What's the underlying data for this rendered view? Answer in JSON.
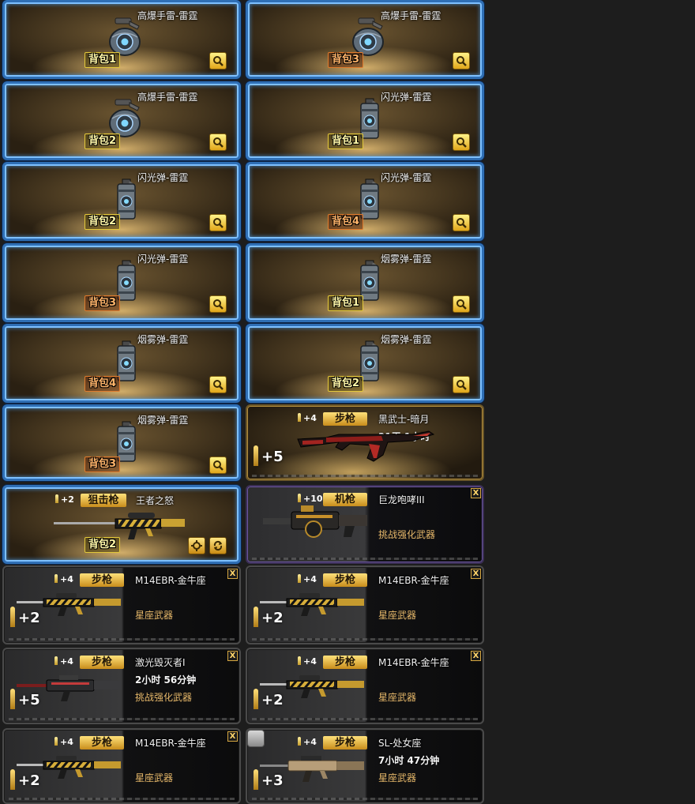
{
  "cards": [
    {
      "style": "blue",
      "kind": "grenade",
      "item": "he",
      "name": "高爆手雷-雷霆",
      "pack": "背包1",
      "packColor": "yellow",
      "btn": "zoom"
    },
    {
      "style": "blue",
      "kind": "grenade",
      "item": "he",
      "name": "高爆手雷-雷霆",
      "pack": "背包3",
      "packColor": "orange",
      "btn": "zoom"
    },
    {
      "style": "blue",
      "kind": "grenade",
      "item": "he",
      "name": "高爆手雷-雷霆",
      "pack": "背包2",
      "packColor": "yellow",
      "btn": "zoom"
    },
    {
      "style": "blue",
      "kind": "grenade",
      "item": "can",
      "name": "闪光弹-雷霆",
      "pack": "背包1",
      "packColor": "yellow",
      "btn": "zoom"
    },
    {
      "style": "blue",
      "kind": "grenade",
      "item": "can",
      "name": "闪光弹-雷霆",
      "pack": "背包2",
      "packColor": "yellow",
      "btn": "zoom"
    },
    {
      "style": "blue",
      "kind": "grenade",
      "item": "can",
      "name": "闪光弹-雷霆",
      "pack": "背包4",
      "packColor": "orange",
      "btn": "zoom"
    },
    {
      "style": "blue",
      "kind": "grenade",
      "item": "can",
      "name": "闪光弹-雷霆",
      "pack": "背包3",
      "packColor": "orange",
      "btn": "zoom"
    },
    {
      "style": "blue",
      "kind": "grenade",
      "item": "can",
      "name": "烟雾弹-雷霆",
      "pack": "背包1",
      "packColor": "yellow",
      "btn": "zoom"
    },
    {
      "style": "blue",
      "kind": "grenade",
      "item": "can",
      "name": "烟雾弹-雷霆",
      "pack": "背包4",
      "packColor": "orange",
      "btn": "zoom"
    },
    {
      "style": "blue",
      "kind": "grenade",
      "item": "can",
      "name": "烟雾弹-雷霆",
      "pack": "背包2",
      "packColor": "yellow",
      "btn": "zoom"
    },
    {
      "style": "blue",
      "kind": "grenade",
      "item": "can",
      "name": "烟雾弹-雷霆",
      "pack": "背包3",
      "packColor": "orange",
      "btn": "zoom"
    },
    {
      "style": "gold",
      "kind": "weapon",
      "item": "ak",
      "name": "黑武士-暗月",
      "line2": "21天 1小时",
      "bonus": "+4",
      "tag": "步枪",
      "level": "+5"
    },
    {
      "style": "blue",
      "kind": "weapon",
      "item": "sniper",
      "name": "王者之怒",
      "bonus": "+2",
      "tag": "狙击枪",
      "pack": "背包2",
      "packColor": "yellow",
      "btn": "tools"
    },
    {
      "style": "purple",
      "kind": "weapon",
      "item": "mg",
      "name": "巨龙咆哮III",
      "bonus": "+10",
      "tag": "机枪",
      "desc": "挑战强化武器",
      "close": "X"
    },
    {
      "style": "dark",
      "kind": "weapon",
      "item": "rifle",
      "name": "M14EBR-金牛座",
      "bonus": "+4",
      "tag": "步枪",
      "desc": "星座武器",
      "level": "+2",
      "close": "X"
    },
    {
      "style": "dark",
      "kind": "weapon",
      "item": "rifle",
      "name": "M14EBR-金牛座",
      "bonus": "+4",
      "tag": "步枪",
      "desc": "星座武器",
      "level": "+2",
      "close": "X"
    },
    {
      "style": "dark",
      "kind": "weapon",
      "item": "laser",
      "name": "激光毁灭者I",
      "line2": "2小时 56分钟",
      "bonus": "+4",
      "tag": "步枪",
      "desc": "挑战强化武器",
      "level": "+5",
      "close": "X"
    },
    {
      "style": "dark",
      "kind": "weapon",
      "item": "rifle",
      "name": "M14EBR-金牛座",
      "bonus": "+4",
      "tag": "步枪",
      "desc": "星座武器",
      "level": "+2",
      "close": "X"
    },
    {
      "style": "dark",
      "kind": "weapon",
      "item": "rifle",
      "name": "M14EBR-金牛座",
      "bonus": "+4",
      "tag": "步枪",
      "desc": "星座武器",
      "level": "+2",
      "close": "X"
    },
    {
      "style": "dark",
      "kind": "weapon",
      "item": "scar",
      "name": "SL-处女座",
      "line2": "7小时 47分钟",
      "bonus": "+4",
      "tag": "步枪",
      "desc": "星座武器",
      "level": "+3",
      "gift": true
    }
  ],
  "colors": {
    "accent_gold": "#e0b040",
    "desc_orange": "#e6b86a",
    "frame_blue": "#2f6fb5"
  }
}
